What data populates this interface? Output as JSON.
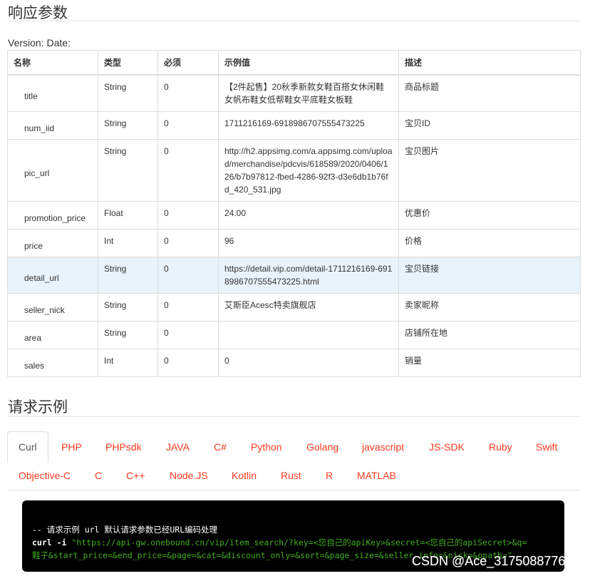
{
  "response_section": {
    "title": "响应参数",
    "version_line": "Version: Date:",
    "columns": [
      "名称",
      "类型",
      "必须",
      "示例值",
      "描述"
    ],
    "rows": [
      {
        "name": "title",
        "type": "String",
        "required": "0",
        "example": "【2件起售】20秋季新款女鞋百搭女休闲鞋女帆布鞋女低帮鞋女平底鞋女板鞋",
        "desc": "商品标题"
      },
      {
        "name": "num_iid",
        "type": "String",
        "required": "0",
        "example": "1711216169-6918986707555473225",
        "desc": "宝贝ID"
      },
      {
        "name": "pic_url",
        "type": "String",
        "required": "0",
        "example": "http://h2.appsimg.com/a.appsimg.com/upload/merchandise/pdcvis/618589/2020/0406/126/b7b97812-fbed-4286-92f3-d3e6db1b76fd_420_531.jpg",
        "desc": "宝贝图片"
      },
      {
        "name": "promotion_price",
        "type": "Float",
        "required": "0",
        "example": "24.00",
        "desc": "优惠价"
      },
      {
        "name": "price",
        "type": "Int",
        "required": "0",
        "example": "96",
        "desc": "价格"
      },
      {
        "name": "detail_url",
        "type": "String",
        "required": "0",
        "example": "https://detail.vip.com/detail-1711216169-6918986707555473225.html",
        "desc": "宝贝链接",
        "highlighted": true
      },
      {
        "name": "seller_nick",
        "type": "String",
        "required": "0",
        "example": "艾斯臣Acesc特卖旗舰店",
        "desc": "卖家昵称"
      },
      {
        "name": "area",
        "type": "String",
        "required": "0",
        "example": "",
        "desc": "店铺所在地"
      },
      {
        "name": "sales",
        "type": "Int",
        "required": "0",
        "example": "0",
        "desc": "销量"
      }
    ]
  },
  "request_section": {
    "title": "请求示例",
    "tabs_row1": [
      "Curl",
      "PHP",
      "PHPsdk",
      "JAVA",
      "C#",
      "Python",
      "Golang",
      "javascript",
      "JS-SDK",
      "Ruby",
      "Swift"
    ],
    "tabs_row2": [
      "Objective-C",
      "C",
      "C++",
      "Node.JS",
      "Kotlin",
      "Rust",
      "R",
      "MATLAB"
    ],
    "active_tab": "Curl",
    "code": {
      "comment": "-- 请求示例 url 默认请求参数已经URL编码处理",
      "cmd": "curl -i",
      "line2_str": "\"https://api-gw.onebound.cn/vip/item_search/?key=<您自己的apiKey>&secret=<您自己的apiSecret>&q=",
      "line3_str": "鞋子&start_price=&end_price=&page=&cat=&discount_only=&sort=&page_size=&seller_info=&nick=&ppath=\""
    }
  },
  "watermark": "CSDN @Ace_3175088776",
  "colors": {
    "tab_link": "#ff3b1f",
    "code_bg": "#000000",
    "code_string": "#3fae1f",
    "row_highlight": "#e8f3fb",
    "border": "#dddddd"
  }
}
